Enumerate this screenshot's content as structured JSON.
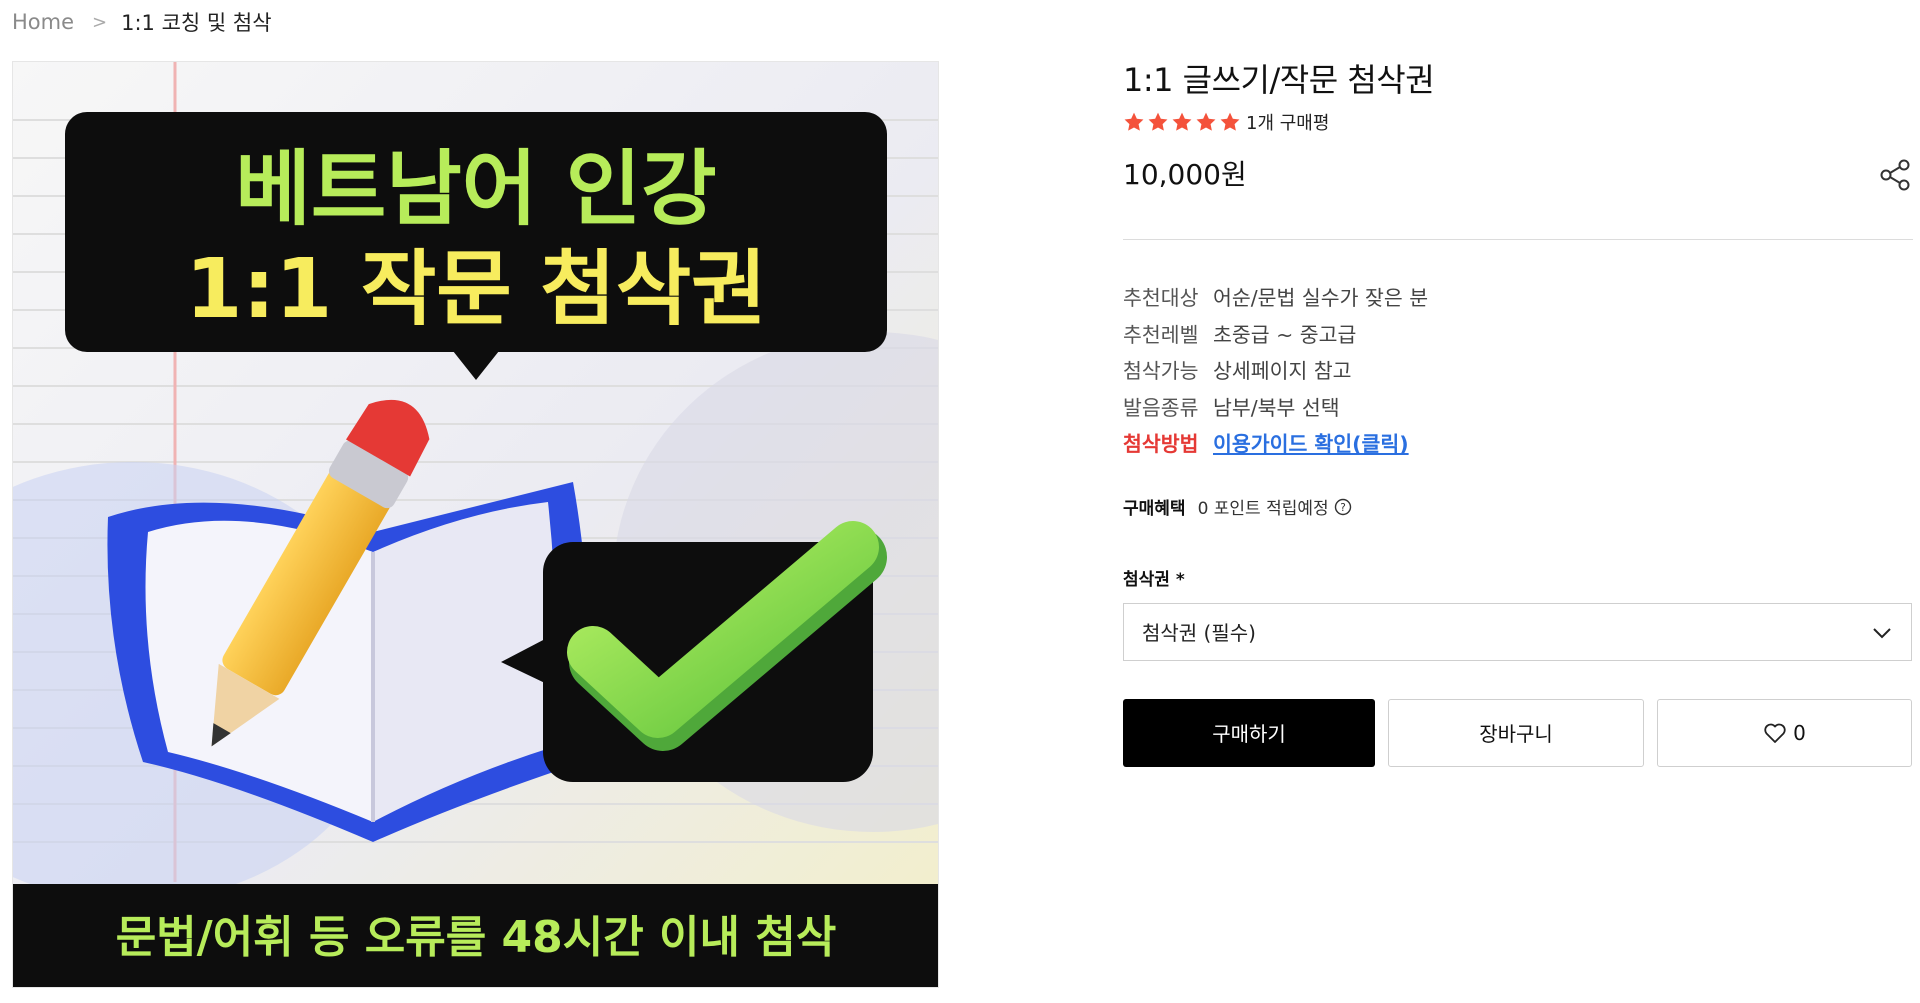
{
  "breadcrumb": {
    "home": "Home",
    "separator": ">",
    "current": "1:1 코칭 및 첨삭"
  },
  "product_image": {
    "headline_line1": "베트남어 인강",
    "headline_line2": "1:1 작문 첨삭권",
    "footer_text": "문법/어휘 등 오류를 48시간 이내 첨삭",
    "icons": [
      "pencil-icon",
      "notebook-icon",
      "checkmark-icon"
    ],
    "colors": {
      "green": "#b7ec5a",
      "yellow": "#f7ec5e",
      "blue": "#2d4de0",
      "black": "#0d0d0d"
    }
  },
  "product": {
    "title": "1:1 글쓰기/작문 첨삭권",
    "rating_stars": 5,
    "rating_max": 5,
    "review_count": "1개 구매평",
    "price": "10,000원",
    "share_icon": "share-icon"
  },
  "specs": [
    {
      "label": "추천대상",
      "value": "어순/문법 실수가 잦은 분"
    },
    {
      "label": "추천레벨",
      "value": "초중급 ~ 중고급"
    },
    {
      "label": "첨삭가능",
      "value": "상세페이지 참고"
    },
    {
      "label": "발음종류",
      "value": "남부/북부 선택"
    },
    {
      "label": "첨삭방법",
      "value": "이용가이드 확인(클릭)"
    }
  ],
  "benefit": {
    "label": "구매혜택",
    "value": "0 포인트 적립예정"
  },
  "option": {
    "label": "첨삭권 *",
    "selected": "첨삭권 (필수)"
  },
  "actions": {
    "buy_label": "구매하기",
    "cart_label": "장바구니",
    "wish_count": "0"
  },
  "colors": {
    "accent_red": "#e53935",
    "link_blue": "#2a6fe0",
    "star": "#f4523b",
    "buy_button": "#000000"
  }
}
